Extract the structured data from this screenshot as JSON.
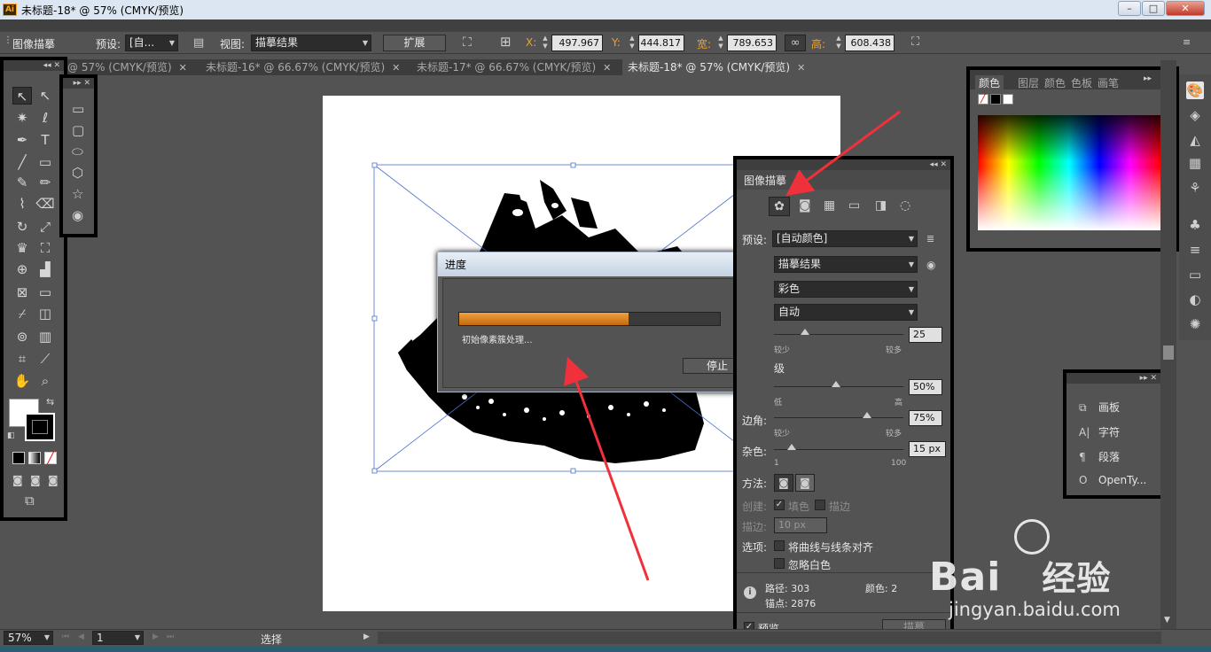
{
  "window": {
    "title": "未标题-18* @ 57% (CMYK/预览)",
    "app_icon": "Ai"
  },
  "control_bar": {
    "panel_label": "图像描摹",
    "preset_label": "预设:",
    "preset_value": "[自...",
    "view_label": "视图:",
    "view_value": "描摹结果",
    "expand_button": "扩展",
    "x_label": "X:",
    "x_value": "497.967",
    "y_label": "Y:",
    "y_value": "444.817",
    "w_label": "宽:",
    "w_value": "789.653",
    "h_label": "高:",
    "h_value": "608.438"
  },
  "tabs": [
    {
      "label": "@ 57% (CMYK/预览)",
      "close": "✕"
    },
    {
      "label": "未标题-16* @ 66.67% (CMYK/预览)",
      "close": "✕"
    },
    {
      "label": "未标题-17* @ 66.67% (CMYK/预览)",
      "close": "✕"
    },
    {
      "label": "未标题-18* @ 57% (CMYK/预览)",
      "close": "✕"
    }
  ],
  "progress_dialog": {
    "title": "进度",
    "message": "初始像素簇处理...",
    "stop_button": "停止",
    "progress": 0.65
  },
  "trace_panel": {
    "title": "图像描摹",
    "preset_label": "预设:",
    "preset_value": "[自动颜色]",
    "view_value": "描摹结果",
    "mode_value": "彩色",
    "palette_value": "自动",
    "colors_min": "较少",
    "colors_max": "较多",
    "colors_value": "25",
    "advanced_label": "级",
    "paths_value": "50%",
    "paths_min": "低",
    "paths_max": "高",
    "corners_label": "边角:",
    "corners_value": "75%",
    "corners_min": "较少",
    "corners_max": "较多",
    "noise_label": "杂色:",
    "noise_value": "15 px",
    "noise_min": "1",
    "noise_max": "100",
    "method_label": "方法:",
    "create_label": "创建:",
    "fill_label": "填色",
    "stroke_label": "描边",
    "stroke_width_label": "描边:",
    "stroke_width_value": "10 px",
    "options_label": "选项:",
    "snap_label": "将曲线与线条对齐",
    "ignore_white_label": "忽略白色",
    "paths_stat_label": "路径:",
    "paths_stat": "303",
    "anchors_stat_label": "锚点:",
    "anchors_stat": "2876",
    "colors_stat_label": "颜色:",
    "colors_stat": "2",
    "preview_label": "预览",
    "trace_button": "描摹"
  },
  "color_panel": {
    "tabs": [
      "颜色",
      "图层",
      "颜色",
      "色板",
      "画笔"
    ]
  },
  "mini_panel": {
    "items": [
      {
        "icon": "⧉",
        "label": "画板"
      },
      {
        "icon": "A|",
        "label": "字符"
      },
      {
        "icon": "¶",
        "label": "段落"
      },
      {
        "icon": "O",
        "label": "OpenTy..."
      }
    ]
  },
  "status_bar": {
    "zoom": "57%",
    "page": "1",
    "tool": "选择"
  },
  "watermark": {
    "brand": "Bai",
    "brand2": "经验",
    "url": "jingyan.baidu.com"
  }
}
